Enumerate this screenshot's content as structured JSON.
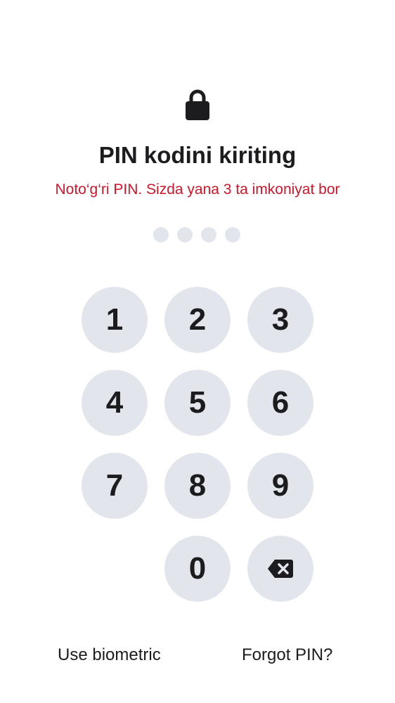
{
  "header": {
    "lock_icon": "lock-icon",
    "title": "PIN kodini kiriting",
    "error_message": "Noto‘g‘ri PIN. Sizda yana 3 ta imkoniyat bor",
    "error_color": "#d0162a"
  },
  "pin": {
    "length": 4,
    "entered": 0
  },
  "keypad": {
    "keys": [
      "1",
      "2",
      "3",
      "4",
      "5",
      "6",
      "7",
      "8",
      "9",
      "",
      "0",
      "backspace"
    ],
    "backspace_icon": "backspace-icon",
    "key_color": "#e2e6ec"
  },
  "footer": {
    "biometric_label": "Use biometric",
    "forgot_label": "Forgot PIN?"
  }
}
